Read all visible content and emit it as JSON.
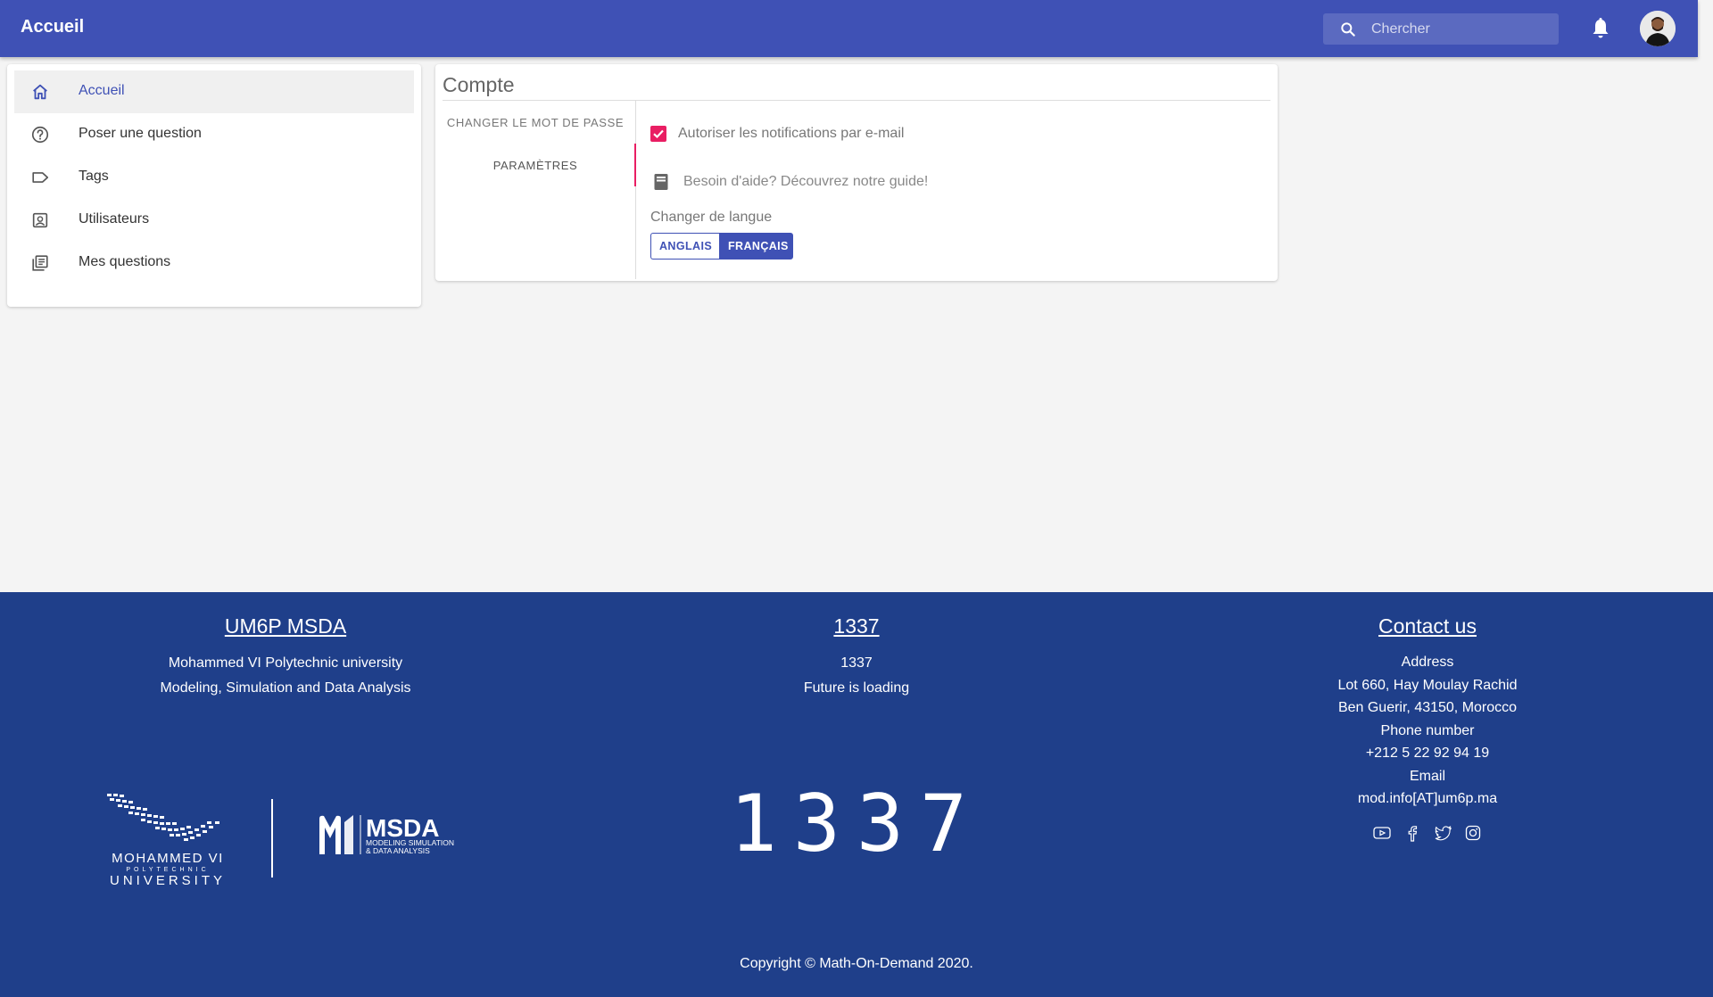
{
  "appbar": {
    "title": "Accueil",
    "search_placeholder": "Chercher",
    "notification_icon": "bell-icon",
    "colors": {
      "primary": "#3f51b5",
      "accent": "#e91e63",
      "footer": "#1f3f8a"
    }
  },
  "sidebar": {
    "items": [
      {
        "label": "Accueil",
        "icon": "home-icon",
        "active": true
      },
      {
        "label": "Poser une question",
        "icon": "help-circle-icon"
      },
      {
        "label": "Tags",
        "icon": "tag-icon"
      },
      {
        "label": "Utilisateurs",
        "icon": "account-box-icon"
      },
      {
        "label": "Mes questions",
        "icon": "library-books-icon"
      }
    ]
  },
  "account": {
    "title": "Compte",
    "tabs": [
      "CHANGER LE MOT DE PASSE",
      "PARAMÈTRES"
    ],
    "active_tab": "PARAMÈTRES",
    "email_notifications_label": "Autoriser les notifications par e-mail",
    "email_notifications_checked": true,
    "help_text": "Besoin d'aide? Découvrez notre guide!",
    "language_label": "Changer de langue",
    "languages": [
      "ANGLAIS",
      "FRANÇAIS"
    ],
    "selected_language": "FRANÇAIS"
  },
  "footer": {
    "col1": {
      "heading": "UM6P MSDA",
      "lines": [
        "Mohammed VI Polytechnic university",
        "Modeling, Simulation and Data Analysis"
      ]
    },
    "col2": {
      "heading": "1337",
      "lines": [
        "1337",
        "Future is loading"
      ]
    },
    "col3": {
      "heading": "Contact us",
      "lines": [
        "Address",
        "Lot 660, Hay Moulay Rachid",
        "Ben Guerir, 43150, Morocco",
        "Phone number",
        "+212 5 22 92 94 19",
        "Email",
        "mod.info[AT]um6p.ma"
      ]
    },
    "social_icons": [
      "youtube-icon",
      "facebook-icon",
      "twitter-icon",
      "instagram-icon"
    ],
    "logos": {
      "um6p_line1": "MOHAMMED VI",
      "um6p_line2": "POLYTECHNIC",
      "um6p_line3": "UNIVERSITY",
      "msda_name": "MSDA",
      "msda_line1": "MODELING SIMULATION",
      "msda_line2": "& DATA ANALYSIS",
      "logo_1337": "1337"
    },
    "copyright": "Copyright © Math-On-Demand 2020."
  }
}
